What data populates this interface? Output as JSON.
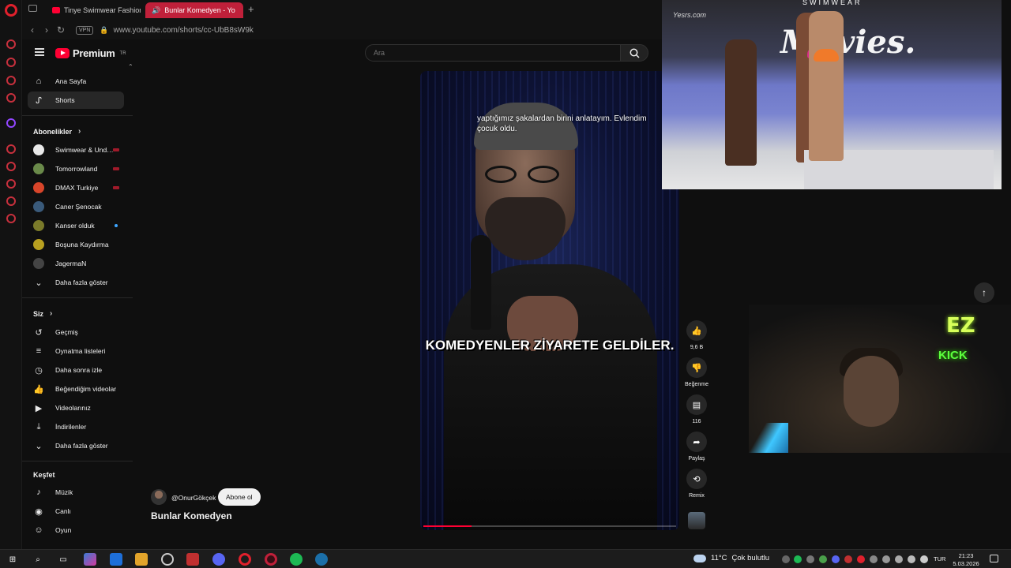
{
  "browser": {
    "tabs": [
      {
        "label": "Tinye Swimwear Fashion S",
        "active": false
      },
      {
        "label": "Bunlar Komedyen - Yo",
        "active": true
      }
    ],
    "vpn_label": "VPN",
    "url": "www.youtube.com/shorts/cc-UbB8sW9k"
  },
  "youtube": {
    "logo_text": "Premium",
    "logo_region": "TR",
    "search_placeholder": "Ara",
    "nav": [
      {
        "label": "Ana Sayfa",
        "icon": "home-icon"
      },
      {
        "label": "Shorts",
        "icon": "shorts-icon",
        "active": true
      }
    ],
    "subscriptions_header": "Abonelikler",
    "subscriptions": [
      {
        "label": "Swimwear & Und…",
        "color": "#e8e8e8",
        "live": true
      },
      {
        "label": "Tomorrowland",
        "color": "#6a8a4a",
        "live": true
      },
      {
        "label": "DMAX Turkiye",
        "color": "#d8452a",
        "live": true
      },
      {
        "label": "Caner Şenocak",
        "color": "#3a5a7a",
        "live": false
      },
      {
        "label": "Kanser olduk",
        "color": "#7a7a2a",
        "live": false,
        "new": true
      },
      {
        "label": "Boşuna Kaydırma",
        "color": "#b8a020",
        "live": false
      },
      {
        "label": "JagermaN",
        "color": "#444444",
        "live": false
      }
    ],
    "show_more": "Daha fazla göster",
    "you_header": "Siz",
    "you_items": [
      {
        "label": "Geçmiş",
        "icon": "history-icon"
      },
      {
        "label": "Oynatma listeleri",
        "icon": "playlists-icon"
      },
      {
        "label": "Daha sonra izle",
        "icon": "watch-later-icon"
      },
      {
        "label": "Beğendiğim videolar",
        "icon": "liked-videos-icon"
      },
      {
        "label": "Videolarınız",
        "icon": "your-videos-icon"
      },
      {
        "label": "İndirilenler",
        "icon": "downloads-icon"
      },
      {
        "label": "Daha fazla göster",
        "icon": "chevron-down-icon"
      }
    ],
    "explore_header": "Keşfet",
    "explore_items": [
      {
        "label": "Müzik",
        "icon": "music-icon"
      },
      {
        "label": "Canlı",
        "icon": "live-icon"
      },
      {
        "label": "Oyun",
        "icon": "gaming-icon"
      }
    ],
    "short": {
      "caption_top": "yaptığımız şakalardan birini anlatayım. Evlendim çocuk oldu.",
      "caption_main": "KOMEDYENLER ZİYARETE GELDİLER.",
      "channel": "@OnurGökçek",
      "subscribe_label": "Abone ol",
      "title": "Bunlar Komedyen",
      "progress": 0.19
    },
    "actions": {
      "like_count": "9,6 B",
      "dislike_label": "Beğenme",
      "comment_count": "116",
      "share_label": "Paylaş",
      "remix_label": "Remix"
    }
  },
  "overlays": {
    "runway_brand": "Movies.",
    "runway_top_text": "SWIMWEAR",
    "runway_watermark": "Yesrs.com",
    "webcam_sign_1": "EZ",
    "webcam_sign_2": "KICK"
  },
  "taskbar": {
    "temperature": "11°C",
    "weather": "Çok bulutlu",
    "language": "TUR",
    "time": "21:23",
    "date": "5.03.2026"
  }
}
